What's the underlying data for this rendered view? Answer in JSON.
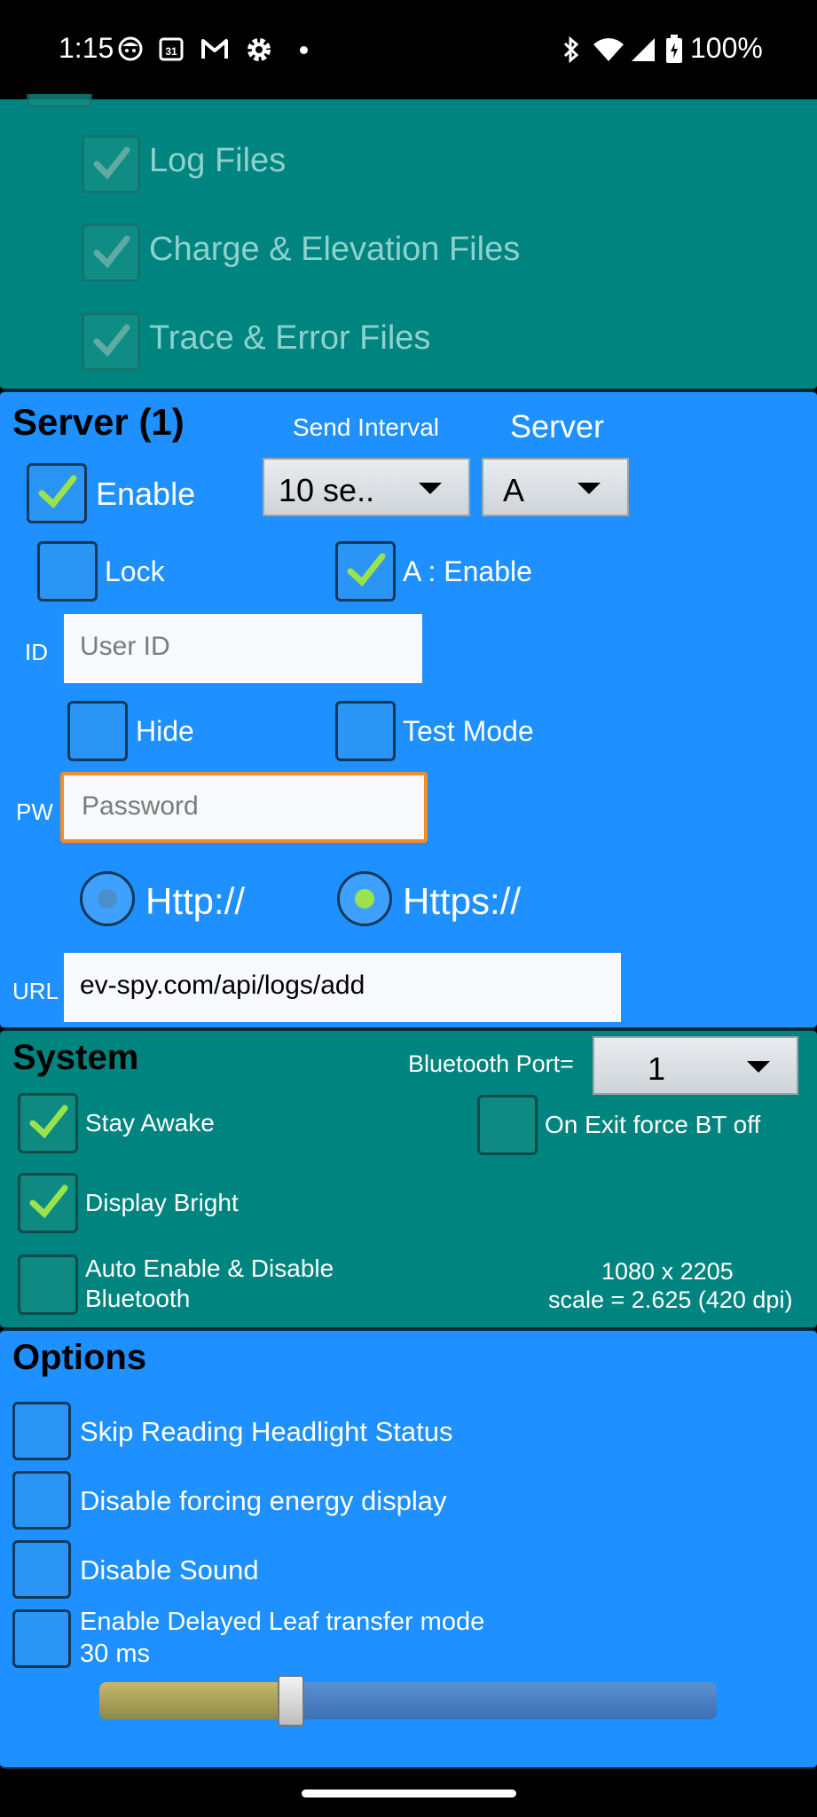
{
  "status_bar": {
    "time": "1:15",
    "battery": "100%",
    "icons": [
      "face-icon",
      "calendar-icon",
      "gmail-icon",
      "settings-icon",
      "dot-icon",
      "bluetooth-icon",
      "wifi-icon",
      "signal-icon",
      "battery-icon"
    ]
  },
  "files_section": {
    "log_files": "Log Files",
    "charge_files": "Charge & Elevation Files",
    "trace_files": "Trace & Error Files"
  },
  "server_section": {
    "title": "Server (1)",
    "send_interval_label": "Send Interval",
    "server_label": "Server",
    "enable_label": "Enable",
    "send_interval_value": "10 se..",
    "server_value": "A",
    "lock_label": "Lock",
    "a_enable_label": "A : Enable",
    "id_label": "ID",
    "user_id_placeholder": "User ID",
    "hide_label": "Hide",
    "test_mode_label": "Test Mode",
    "pw_label": "PW",
    "password_placeholder": "Password",
    "http_label": "Http://",
    "https_label": "Https://",
    "url_label": "URL",
    "url_value": "ev-spy.com/api/logs/add"
  },
  "system_section": {
    "title": "System",
    "bt_port_label": "Bluetooth Port=",
    "bt_port_value": "1",
    "stay_awake": "Stay Awake",
    "exit_bt_off": "On Exit force BT off",
    "display_bright": "Display Bright",
    "auto_bt_line1": "Auto Enable & Disable",
    "auto_bt_line2": "Bluetooth",
    "resolution": "1080 x 2205",
    "scale": "scale = 2.625 (420 dpi)"
  },
  "options_section": {
    "title": "Options",
    "skip_headlight": "Skip Reading Headlight Status",
    "disable_energy": "Disable forcing energy display",
    "disable_sound": "Disable Sound",
    "delayed_leaf": "Enable Delayed Leaf transfer mode",
    "delay_value": "30 ms",
    "slider_fraction": 0.31
  },
  "colors": {
    "teal": "#00847f",
    "blue": "#1e90ff",
    "check_green": "#9be34b",
    "focus_orange": "#f08c2a"
  }
}
